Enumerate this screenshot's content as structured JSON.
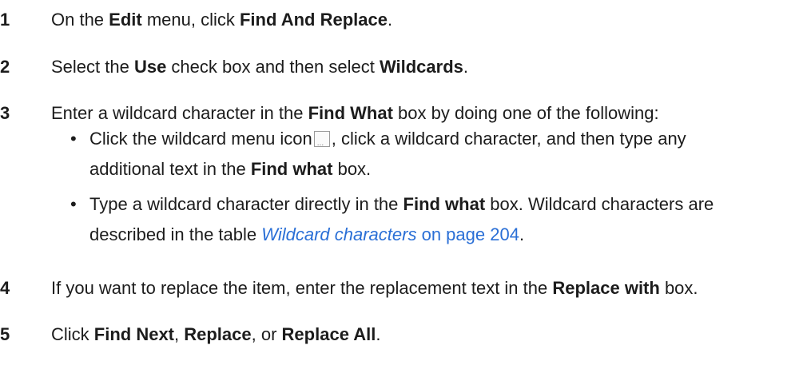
{
  "steps": [
    {
      "num": "1",
      "p1": "On the ",
      "b1": "Edit",
      "p2": " menu, click ",
      "b2": "Find And Replace",
      "p3": "."
    },
    {
      "num": "2",
      "p1": "Select the ",
      "b1": "Use",
      "p2": " check box and then select ",
      "b2": "Wildcards",
      "p3": "."
    },
    {
      "num": "3",
      "p1": "Enter a wildcard character in the ",
      "b1": "Find What",
      "p2": " box by doing one of the following:"
    },
    {
      "num": "4",
      "p1": "If you want to replace the item, enter the replacement text in the ",
      "b1": "Replace with",
      "p2": " box."
    },
    {
      "num": "5",
      "p1": "Click ",
      "b1": "Find Next",
      "p2": ", ",
      "b2": "Replace",
      "p3": ", or ",
      "b3": "Replace All",
      "p4": "."
    }
  ],
  "bullets": {
    "b1_l1_p1": "Click the wildcard menu icon",
    "b1_l1_p2": ", click a wildcard character, and then type any",
    "b1_l2_p1": "additional text in the ",
    "b1_l2_b1": "Find what",
    "b1_l2_p2": " box.",
    "b2_l1_p1": "Type a wildcard character directly in the ",
    "b2_l1_b1": "Find what",
    "b2_l1_p2": " box. Wildcard characters are",
    "b2_l2_p1": "described in the table ",
    "b2_l2_link": "Wildcard characters",
    "b2_l2_link2": " on page 204",
    "b2_l2_p2": "."
  },
  "icons": {
    "bullet": "•",
    "wildcard_menu": "ellipsis-button-icon"
  }
}
